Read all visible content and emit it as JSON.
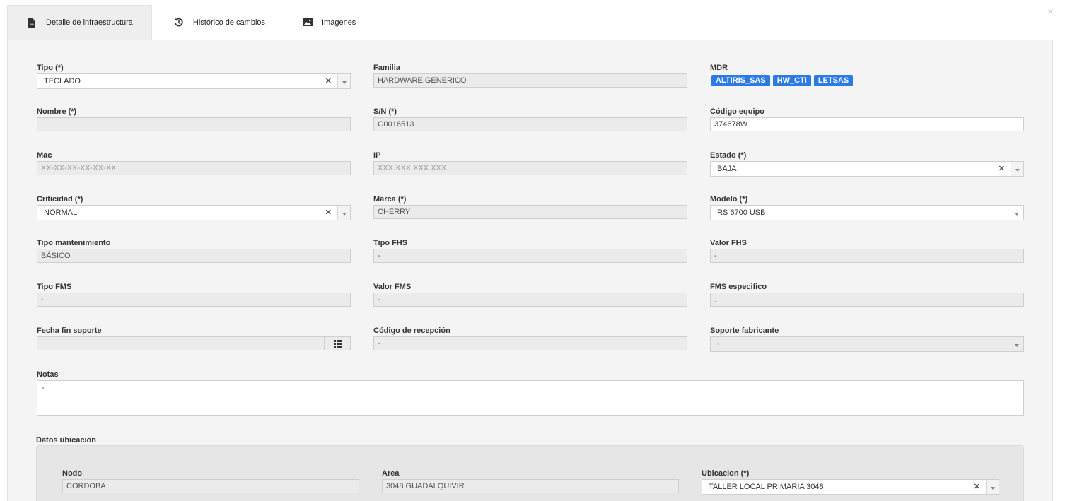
{
  "tabs": [
    {
      "label": "Detalle de infraestructura",
      "icon": "document-icon",
      "active": true
    },
    {
      "label": "Histórico de cambios",
      "icon": "history-icon",
      "active": false
    },
    {
      "label": "Imagenes",
      "icon": "image-icon",
      "active": false
    }
  ],
  "close_label": "×",
  "fields": {
    "tipo": {
      "label": "Tipo (*)",
      "value": "TECLADO"
    },
    "familia": {
      "label": "Familia",
      "value": "HARDWARE.GENERICO"
    },
    "mdr": {
      "label": "MDR",
      "tags": [
        "ALTIRIS_SAS",
        "HW_CTI",
        "LETSAS"
      ]
    },
    "nombre": {
      "label": "Nombre (*)",
      "value": "."
    },
    "sn": {
      "label": "S/N (*)",
      "value": "G0016513"
    },
    "codigo_equipo": {
      "label": "Código equipo",
      "value": "374678W"
    },
    "mac": {
      "label": "Mac",
      "placeholder": "XX-XX-XX-XX-XX-XX"
    },
    "ip": {
      "label": "IP",
      "placeholder": "XXX.XXX.XXX.XXX"
    },
    "estado": {
      "label": "Estado (*)",
      "value": "BAJA"
    },
    "criticidad": {
      "label": "Criticidad (*)",
      "value": "NORMAL"
    },
    "marca": {
      "label": "Marca (*)",
      "value": "CHERRY"
    },
    "modelo": {
      "label": "Modelo (*)",
      "value": "RS 6700 USB"
    },
    "tipo_mantenimiento": {
      "label": "Tipo mantenimiento",
      "value": "BÁSICO"
    },
    "tipo_fhs": {
      "label": "Tipo FHS",
      "value": "-"
    },
    "valor_fhs": {
      "label": "Valor FHS",
      "value": "-"
    },
    "tipo_fms": {
      "label": "Tipo FMS",
      "value": "-"
    },
    "valor_fms": {
      "label": "Valor FMS",
      "value": "-"
    },
    "fms_especifico": {
      "label": "FMS especifico",
      "value": "."
    },
    "fecha_fin_soporte": {
      "label": "Fecha fin soporte",
      "value": ""
    },
    "codigo_recepcion": {
      "label": "Código de recepción",
      "value": "-"
    },
    "soporte_fabricante": {
      "label": "Soporte fabricante",
      "value": "-"
    },
    "notas": {
      "label": "Notas",
      "value": "-"
    }
  },
  "ubicacion": {
    "title": "Datos ubicacion",
    "nodo": {
      "label": "Nodo",
      "value": "CORDOBA"
    },
    "area": {
      "label": "Area",
      "value": "3048 GUADALQUIVIR"
    },
    "ubicacion": {
      "label": "Ubicacion (*)",
      "value": "TALLER LOCAL PRIMARIA 3048"
    }
  },
  "colors": {
    "tag": "#2c7be5",
    "panel": "#f4f4f4",
    "subpanel": "#e6e6e6"
  }
}
